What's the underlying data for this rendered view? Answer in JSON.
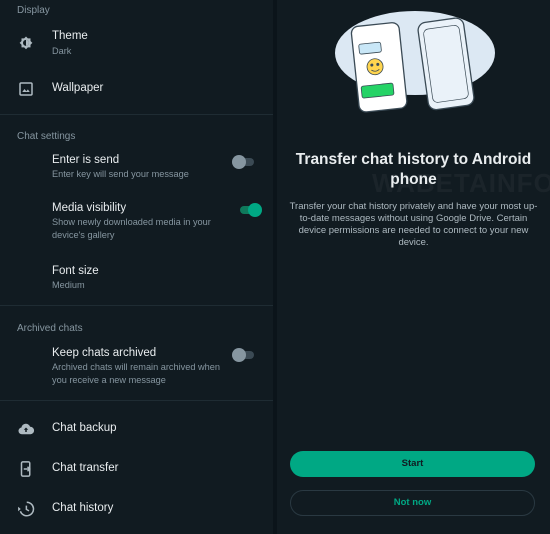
{
  "settings": {
    "display_header": "Display",
    "theme": {
      "title": "Theme",
      "value": "Dark"
    },
    "wallpaper": {
      "title": "Wallpaper"
    },
    "chat_settings_header": "Chat settings",
    "enter_is_send": {
      "title": "Enter is send",
      "sub": "Enter key will send your message",
      "enabled": false
    },
    "media_visibility": {
      "title": "Media visibility",
      "sub": "Show newly downloaded media in your device's gallery",
      "enabled": true
    },
    "font_size": {
      "title": "Font size",
      "value": "Medium"
    },
    "archived_header": "Archived chats",
    "keep_archived": {
      "title": "Keep chats archived",
      "sub": "Archived chats will remain archived when you receive a new message",
      "enabled": false
    },
    "chat_backup": "Chat backup",
    "chat_transfer": "Chat transfer",
    "chat_history": "Chat history"
  },
  "transfer": {
    "title": "Transfer chat history to Android phone",
    "body": "Transfer your chat history privately and have your most up-to-date messages without using Google Drive. Certain device permissions are needed to connect to your new device.",
    "start_label": "Start",
    "not_now_label": "Not now"
  },
  "colors": {
    "background": "#111b21",
    "accent": "#00a884",
    "secondary_text": "#8696a0"
  },
  "icons": [
    "brightness-icon",
    "wallpaper-icon",
    "cloud-upload-icon",
    "phone-transfer-icon",
    "history-icon"
  ]
}
